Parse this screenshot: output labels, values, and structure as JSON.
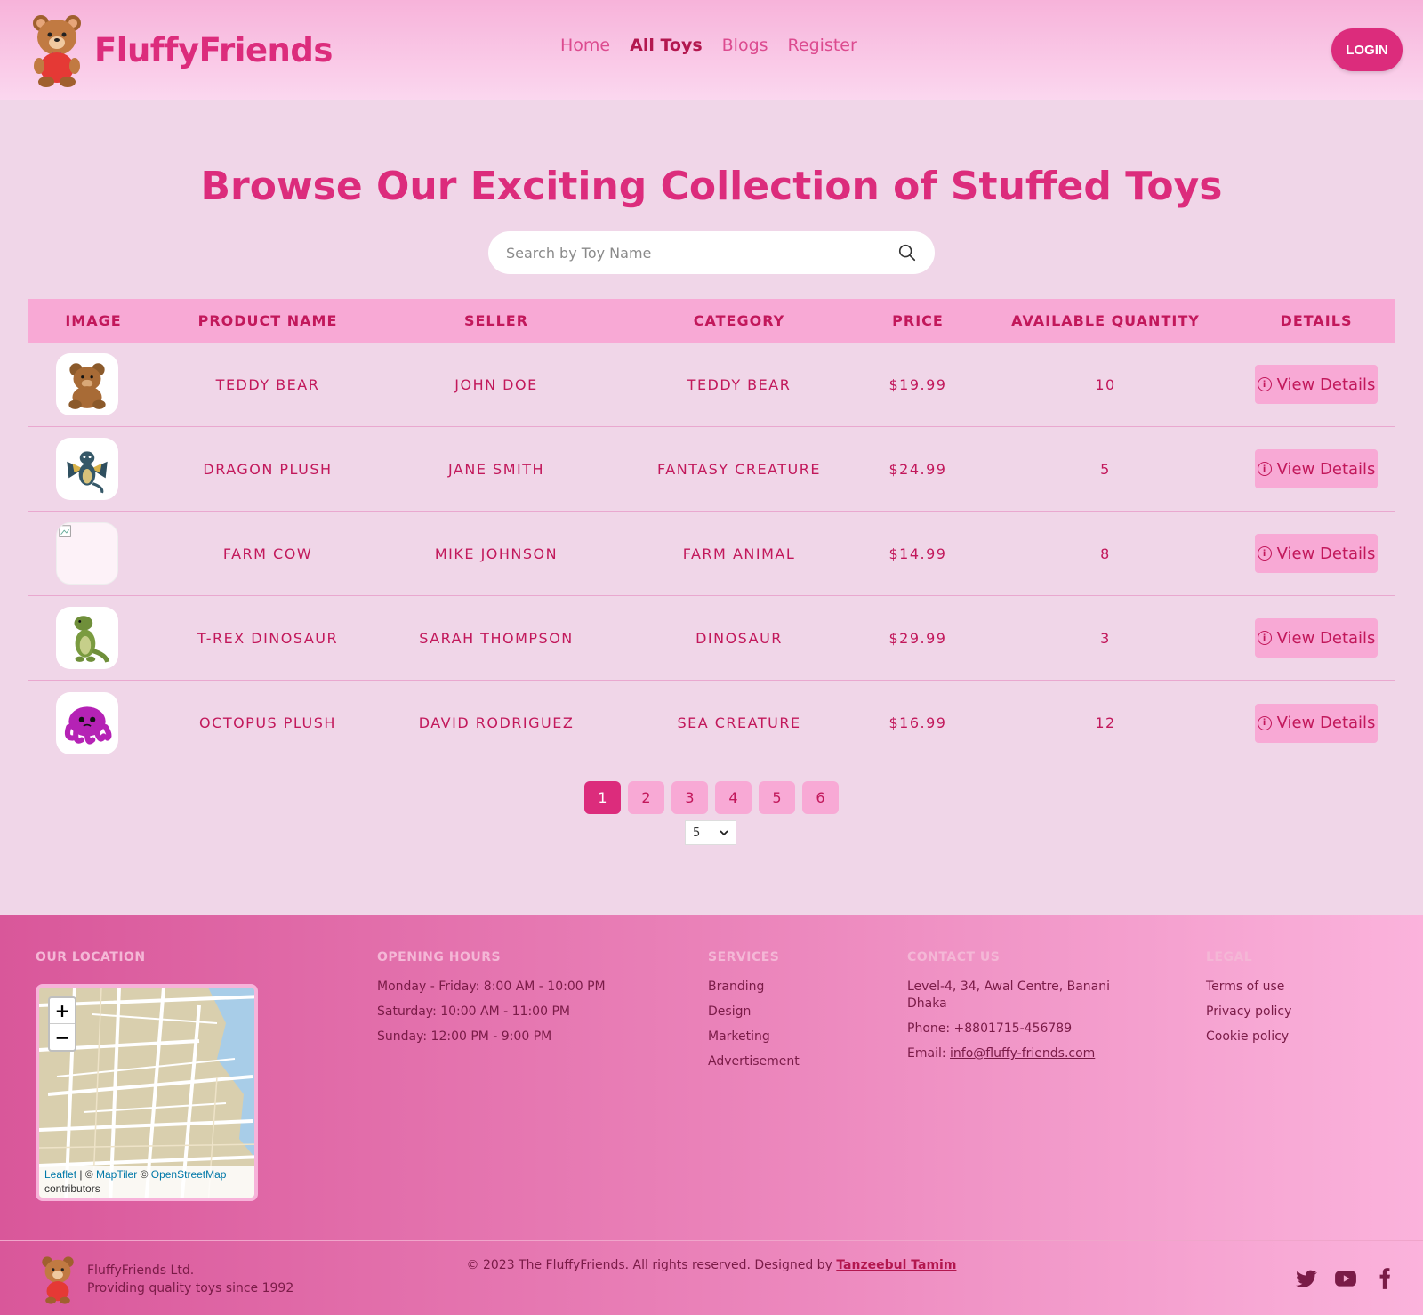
{
  "header": {
    "brand": "FluffyFriends",
    "nav": [
      {
        "label": "Home",
        "active": false
      },
      {
        "label": "All Toys",
        "active": true
      },
      {
        "label": "Blogs",
        "active": false
      },
      {
        "label": "Register",
        "active": false
      }
    ],
    "login_label": "LOGIN"
  },
  "main": {
    "title": "Browse Our Exciting Collection of Stuffed Toys",
    "search_placeholder": "Search by Toy Name"
  },
  "table": {
    "columns": [
      "IMAGE",
      "PRODUCT NAME",
      "SELLER",
      "CATEGORY",
      "PRICE",
      "AVAILABLE QUANTITY",
      "DETAILS"
    ],
    "rows": [
      {
        "image": "teddy-bear",
        "name": "TEDDY BEAR",
        "seller": "JOHN DOE",
        "category": "TEDDY BEAR",
        "price": "$19.99",
        "qty": "10",
        "details": "View Details"
      },
      {
        "image": "dragon",
        "name": "DRAGON PLUSH",
        "seller": "JANE SMITH",
        "category": "FANTASY CREATURE",
        "price": "$24.99",
        "qty": "5",
        "details": "View Details"
      },
      {
        "image": "broken",
        "name": "FARM COW",
        "seller": "MIKE JOHNSON",
        "category": "FARM ANIMAL",
        "price": "$14.99",
        "qty": "8",
        "details": "View Details"
      },
      {
        "image": "dinosaur",
        "name": "T-REX DINOSAUR",
        "seller": "SARAH THOMPSON",
        "category": "DINOSAUR",
        "price": "$29.99",
        "qty": "3",
        "details": "View Details"
      },
      {
        "image": "octopus",
        "name": "OCTOPUS PLUSH",
        "seller": "DAVID RODRIGUEZ",
        "category": "SEA CREATURE",
        "price": "$16.99",
        "qty": "12",
        "details": "View Details"
      }
    ]
  },
  "pagination": {
    "pages": [
      "1",
      "2",
      "3",
      "4",
      "5",
      "6"
    ],
    "current": "1",
    "per_page": "5"
  },
  "footer": {
    "location": {
      "heading": "OUR LOCATION",
      "map_attribution_1": "Leaflet",
      "map_attribution_2": "MapTiler",
      "map_attribution_3": "OpenStreetMap",
      "map_attribution_4": "contributors",
      "zoom_in": "+",
      "zoom_out": "−"
    },
    "hours": {
      "heading": "OPENING HOURS",
      "lines": [
        "Monday - Friday: 8:00 AM - 10:00 PM",
        "Saturday: 10:00 AM - 11:00 PM",
        "Sunday: 12:00 PM - 9:00 PM"
      ]
    },
    "services": {
      "heading": "SERVICES",
      "items": [
        "Branding",
        "Design",
        "Marketing",
        "Advertisement"
      ]
    },
    "contact": {
      "heading": "CONTACT US",
      "address": "Level-4, 34, Awal Centre, Banani Dhaka",
      "phone": "Phone: +8801715-456789",
      "email_label": "Email: ",
      "email": "info@fluffy-friends.com"
    },
    "legal": {
      "heading": "LEGAL",
      "items": [
        "Terms of use",
        "Privacy policy",
        "Cookie policy"
      ]
    },
    "company_name": "FluffyFriends Ltd.",
    "tagline": "Providing quality toys since 1992",
    "copyright": "© 2023 The FluffyFriends. All rights reserved. Designed by ",
    "designer": "Tanzeebul Tamim",
    "socials": [
      "twitter-icon",
      "youtube-icon",
      "facebook-icon"
    ]
  },
  "colors": {
    "accent": "#dc2c7c",
    "header_bg": "#f7b3da",
    "table_header_bg": "#f8a9d5",
    "page_bg": "#f0d6e8"
  }
}
